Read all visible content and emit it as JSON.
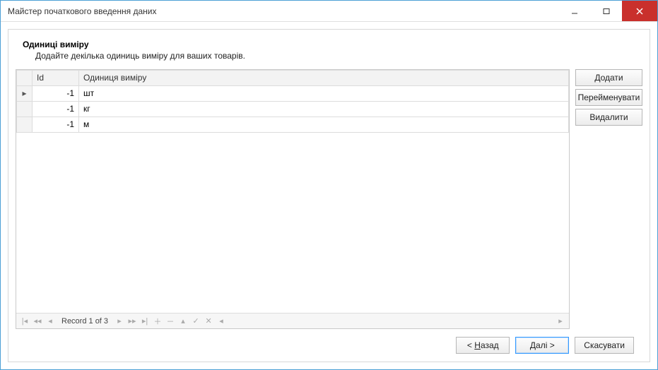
{
  "window": {
    "title": "Майстер початкового введення даних"
  },
  "header": {
    "heading": "Одиниці виміру",
    "subheading": "Додайте декілька одиниць виміру для ваших товарів."
  },
  "grid": {
    "columns": {
      "id": "Id",
      "unit": "Одиниця виміру"
    },
    "rows": [
      {
        "id": "-1",
        "unit": "шт"
      },
      {
        "id": "-1",
        "unit": "кг"
      },
      {
        "id": "-1",
        "unit": "м"
      }
    ],
    "navigator": {
      "text": "Record 1 of 3",
      "first": "⏮",
      "prevpage": "⏪",
      "prev": "◀",
      "next": "▶",
      "nextpage": "⏩",
      "last": "⏭",
      "add": "＋",
      "delete": "－",
      "edit": "✎",
      "accept": "✓",
      "cancel": "✕",
      "scroll_left": "◀",
      "scroll_right": "▶"
    }
  },
  "side": {
    "add": "Додати",
    "rename": "Перейменувати",
    "delete": "Видалити"
  },
  "footer": {
    "back_lt": "<",
    "back_text": "Назад",
    "next_text": "Далі",
    "next_gt": ">",
    "cancel": "Скасувати"
  }
}
